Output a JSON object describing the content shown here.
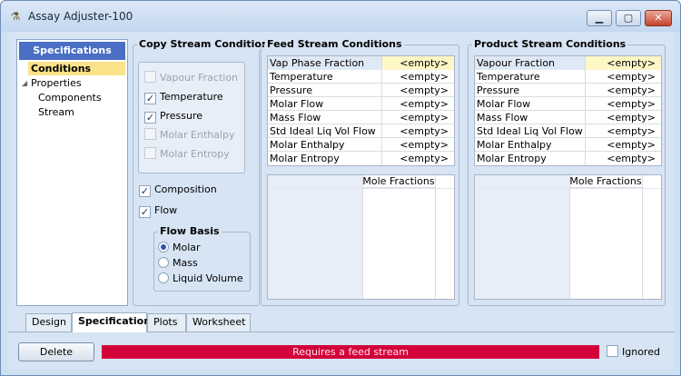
{
  "window": {
    "title": "Assay Adjuster-100",
    "buttons": {
      "minimize": "▁",
      "restore": "▢",
      "close": "✕"
    },
    "app_icon": "assay-adjuster-icon"
  },
  "tree": {
    "header": "Specifications",
    "items": [
      {
        "label": "Conditions",
        "selected": true
      },
      {
        "label": "Properties",
        "expandable": true
      },
      {
        "label": "Components"
      },
      {
        "label": "Stream"
      }
    ]
  },
  "copy_conditions": {
    "title": "Copy Stream Conditions",
    "inner": [
      {
        "label": "Vapour Fraction",
        "checked": false,
        "enabled": false
      },
      {
        "label": "Temperature",
        "checked": true,
        "enabled": true
      },
      {
        "label": "Pressure",
        "checked": true,
        "enabled": true
      },
      {
        "label": "Molar Enthalpy",
        "checked": false,
        "enabled": false
      },
      {
        "label": "Molar Entropy",
        "checked": false,
        "enabled": false
      }
    ],
    "composition": {
      "label": "Composition",
      "checked": true
    },
    "flow": {
      "label": "Flow",
      "checked": true
    },
    "flow_basis": {
      "title": "Flow Basis",
      "options": [
        {
          "label": "Molar",
          "selected": true
        },
        {
          "label": "Mass",
          "selected": false
        },
        {
          "label": "Liquid Volume",
          "selected": false
        }
      ]
    }
  },
  "feed": {
    "title": "Feed Stream Conditions",
    "rows": [
      {
        "name": "Vap Phase Fraction",
        "value": "<empty>"
      },
      {
        "name": "Temperature",
        "value": "<empty>"
      },
      {
        "name": "Pressure",
        "value": "<empty>"
      },
      {
        "name": "Molar Flow",
        "value": "<empty>"
      },
      {
        "name": "Mass Flow",
        "value": "<empty>"
      },
      {
        "name": "Std Ideal Liq Vol Flow",
        "value": "<empty>"
      },
      {
        "name": "Molar Enthalpy",
        "value": "<empty>"
      },
      {
        "name": "Molar Entropy",
        "value": "<empty>"
      }
    ],
    "fractions_header": "Mole Fractions"
  },
  "product": {
    "title": "Product Stream Conditions",
    "rows": [
      {
        "name": "Vapour Fraction",
        "value": "<empty>"
      },
      {
        "name": "Temperature",
        "value": "<empty>"
      },
      {
        "name": "Pressure",
        "value": "<empty>"
      },
      {
        "name": "Molar Flow",
        "value": "<empty>"
      },
      {
        "name": "Mass Flow",
        "value": "<empty>"
      },
      {
        "name": "Std Ideal Liq Vol Flow",
        "value": "<empty>"
      },
      {
        "name": "Molar Enthalpy",
        "value": "<empty>"
      },
      {
        "name": "Molar Entropy",
        "value": "<empty>"
      }
    ],
    "fractions_header": "Mole Fractions"
  },
  "tabs": [
    {
      "label": "Design",
      "active": false
    },
    {
      "label": "Specifications",
      "active": true
    },
    {
      "label": "Plots",
      "active": false
    },
    {
      "label": "Worksheet",
      "active": false
    }
  ],
  "bottom": {
    "delete_label": "Delete",
    "status_text": "Requires a feed stream",
    "status_color": "#d3023a",
    "ignored_label": "Ignored",
    "ignored_checked": false
  }
}
